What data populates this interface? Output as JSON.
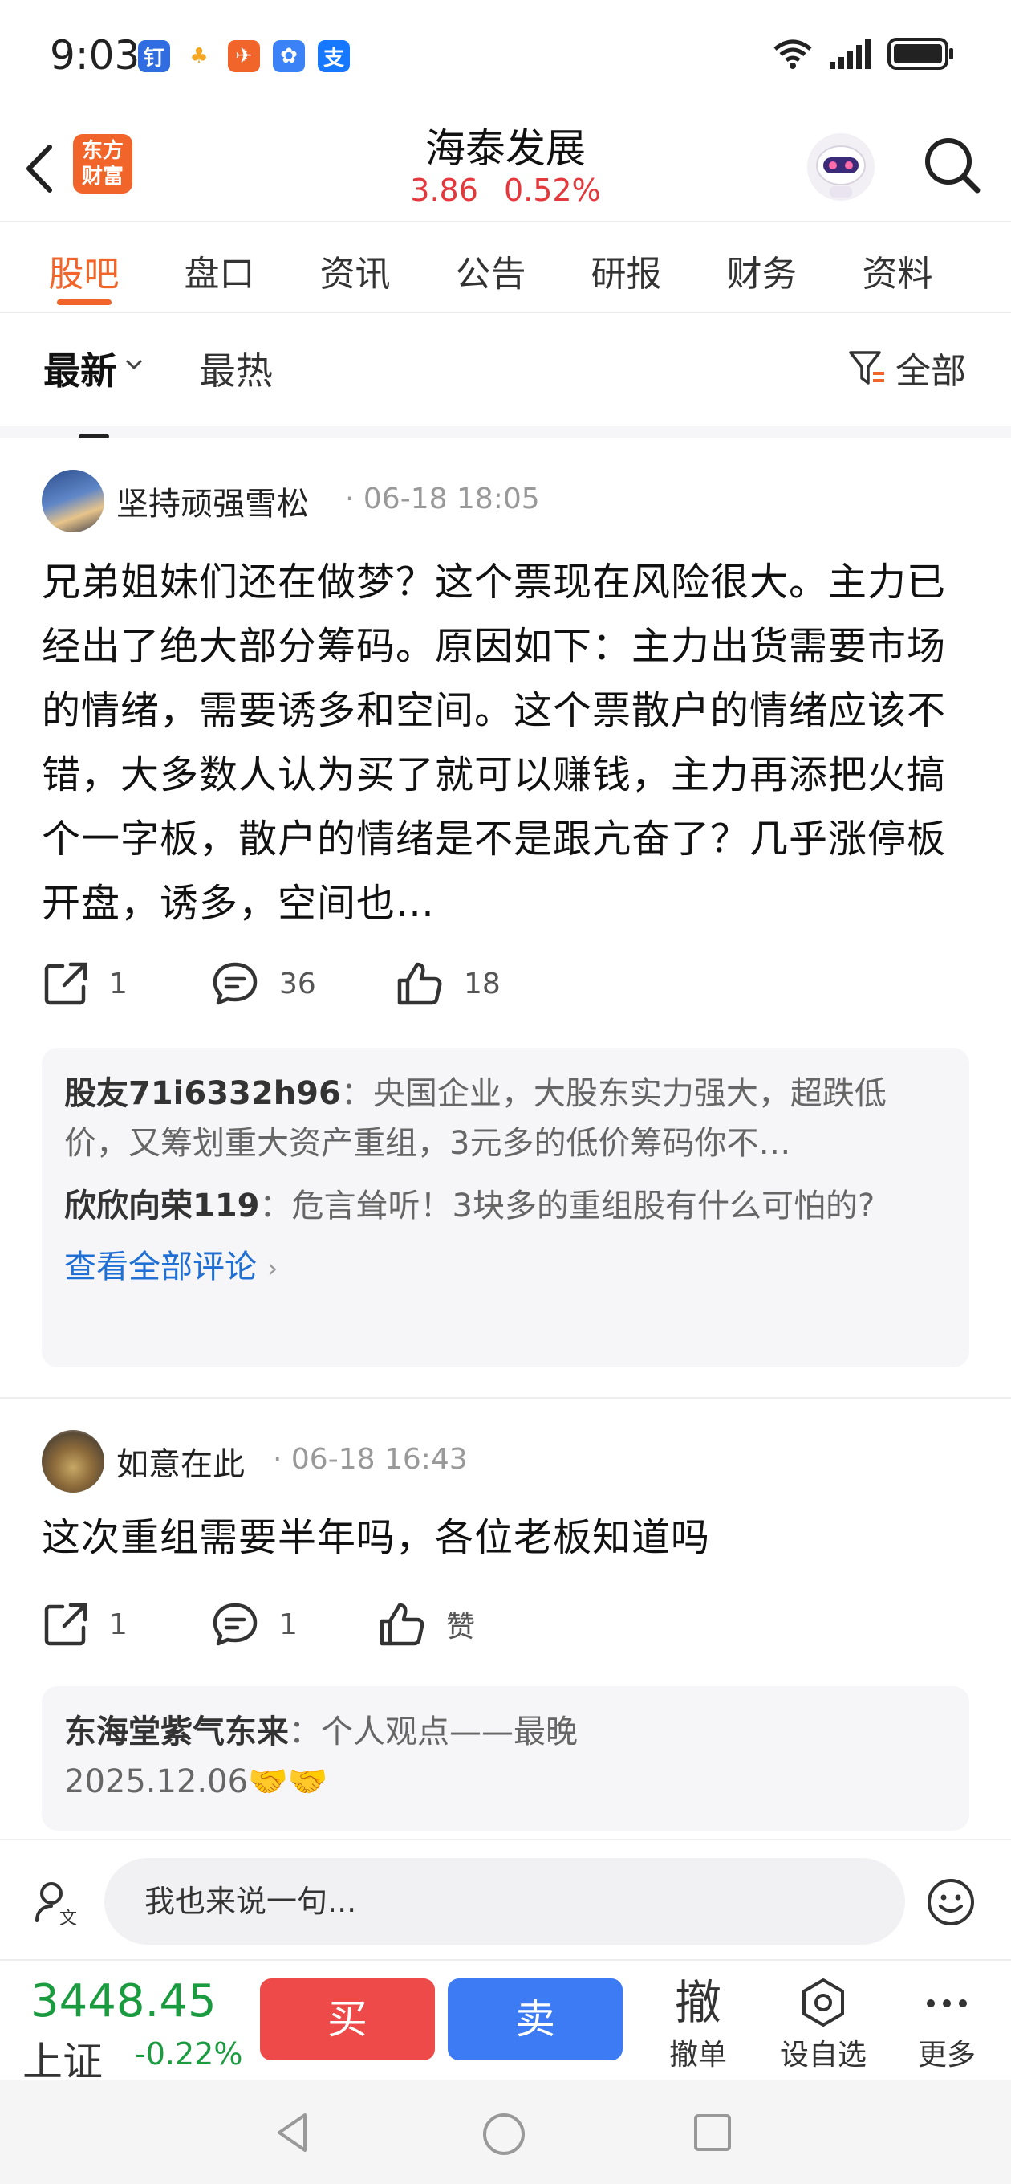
{
  "status_bar": {
    "time": "9:03",
    "app_icons": [
      "钉",
      "♣",
      "✈",
      "✿",
      "支"
    ]
  },
  "header": {
    "logo_text": "东方财富",
    "stock_name": "海泰发展",
    "price": "3.86",
    "change_pct": "0.52%"
  },
  "tabs": [
    {
      "label": "股吧",
      "active": true
    },
    {
      "label": "盘口"
    },
    {
      "label": "资讯"
    },
    {
      "label": "公告"
    },
    {
      "label": "研报"
    },
    {
      "label": "财务"
    },
    {
      "label": "资料"
    }
  ],
  "sort": {
    "latest": "最新",
    "hot": "最热",
    "filter": "全部"
  },
  "posts": [
    {
      "author": "坚持顽强雪松",
      "time": "06-18 18:05",
      "content": "兄弟姐妹们还在做梦？这个票现在风险很大。主力已经出了绝大部分筹码。原因如下：主力出货需要市场的情绪，需要诱多和空间。这个票散户的情绪应该不错，大多数人认为买了就可以赚钱，主力再添把火搞个一字板，散户的情绪是不是跟亢奋了？几乎涨停板开盘，诱多，空间也…",
      "shares": "1",
      "comments_count": "36",
      "likes": "18",
      "comments": [
        {
          "user": "股友71i6332h96",
          "text": "：央国企业，大股东实力强大，超跌低价，又筹划重大资产重组，3元多的低价筹码你不…"
        },
        {
          "user": "欣欣向荣119",
          "text": "：危言耸听！3块多的重组股有什么可怕的?"
        }
      ],
      "view_all": "查看全部评论"
    },
    {
      "author": "如意在此",
      "time": "06-18 16:43",
      "content": "这次重组需要半年吗，各位老板知道吗",
      "shares": "1",
      "comments_count": "1",
      "likes": "赞",
      "comments": [
        {
          "user": "东海堂紫气东来",
          "text": "：个人观点——最晚2025.12.06🤝🤝"
        }
      ]
    }
  ],
  "input": {
    "placeholder": "我也来说一句..."
  },
  "trade_bar": {
    "index_value": "3448.45",
    "index_name": "上证",
    "index_change": "-0.22%",
    "buy": "买",
    "sell": "卖",
    "cancel_big": "撤",
    "cancel": "撤单",
    "watchlist": "设自选",
    "more": "更多"
  },
  "colors": {
    "accent": "#f2652a",
    "up": "#e4393c",
    "down": "#1a9b3f",
    "link": "#1f6fd4"
  }
}
